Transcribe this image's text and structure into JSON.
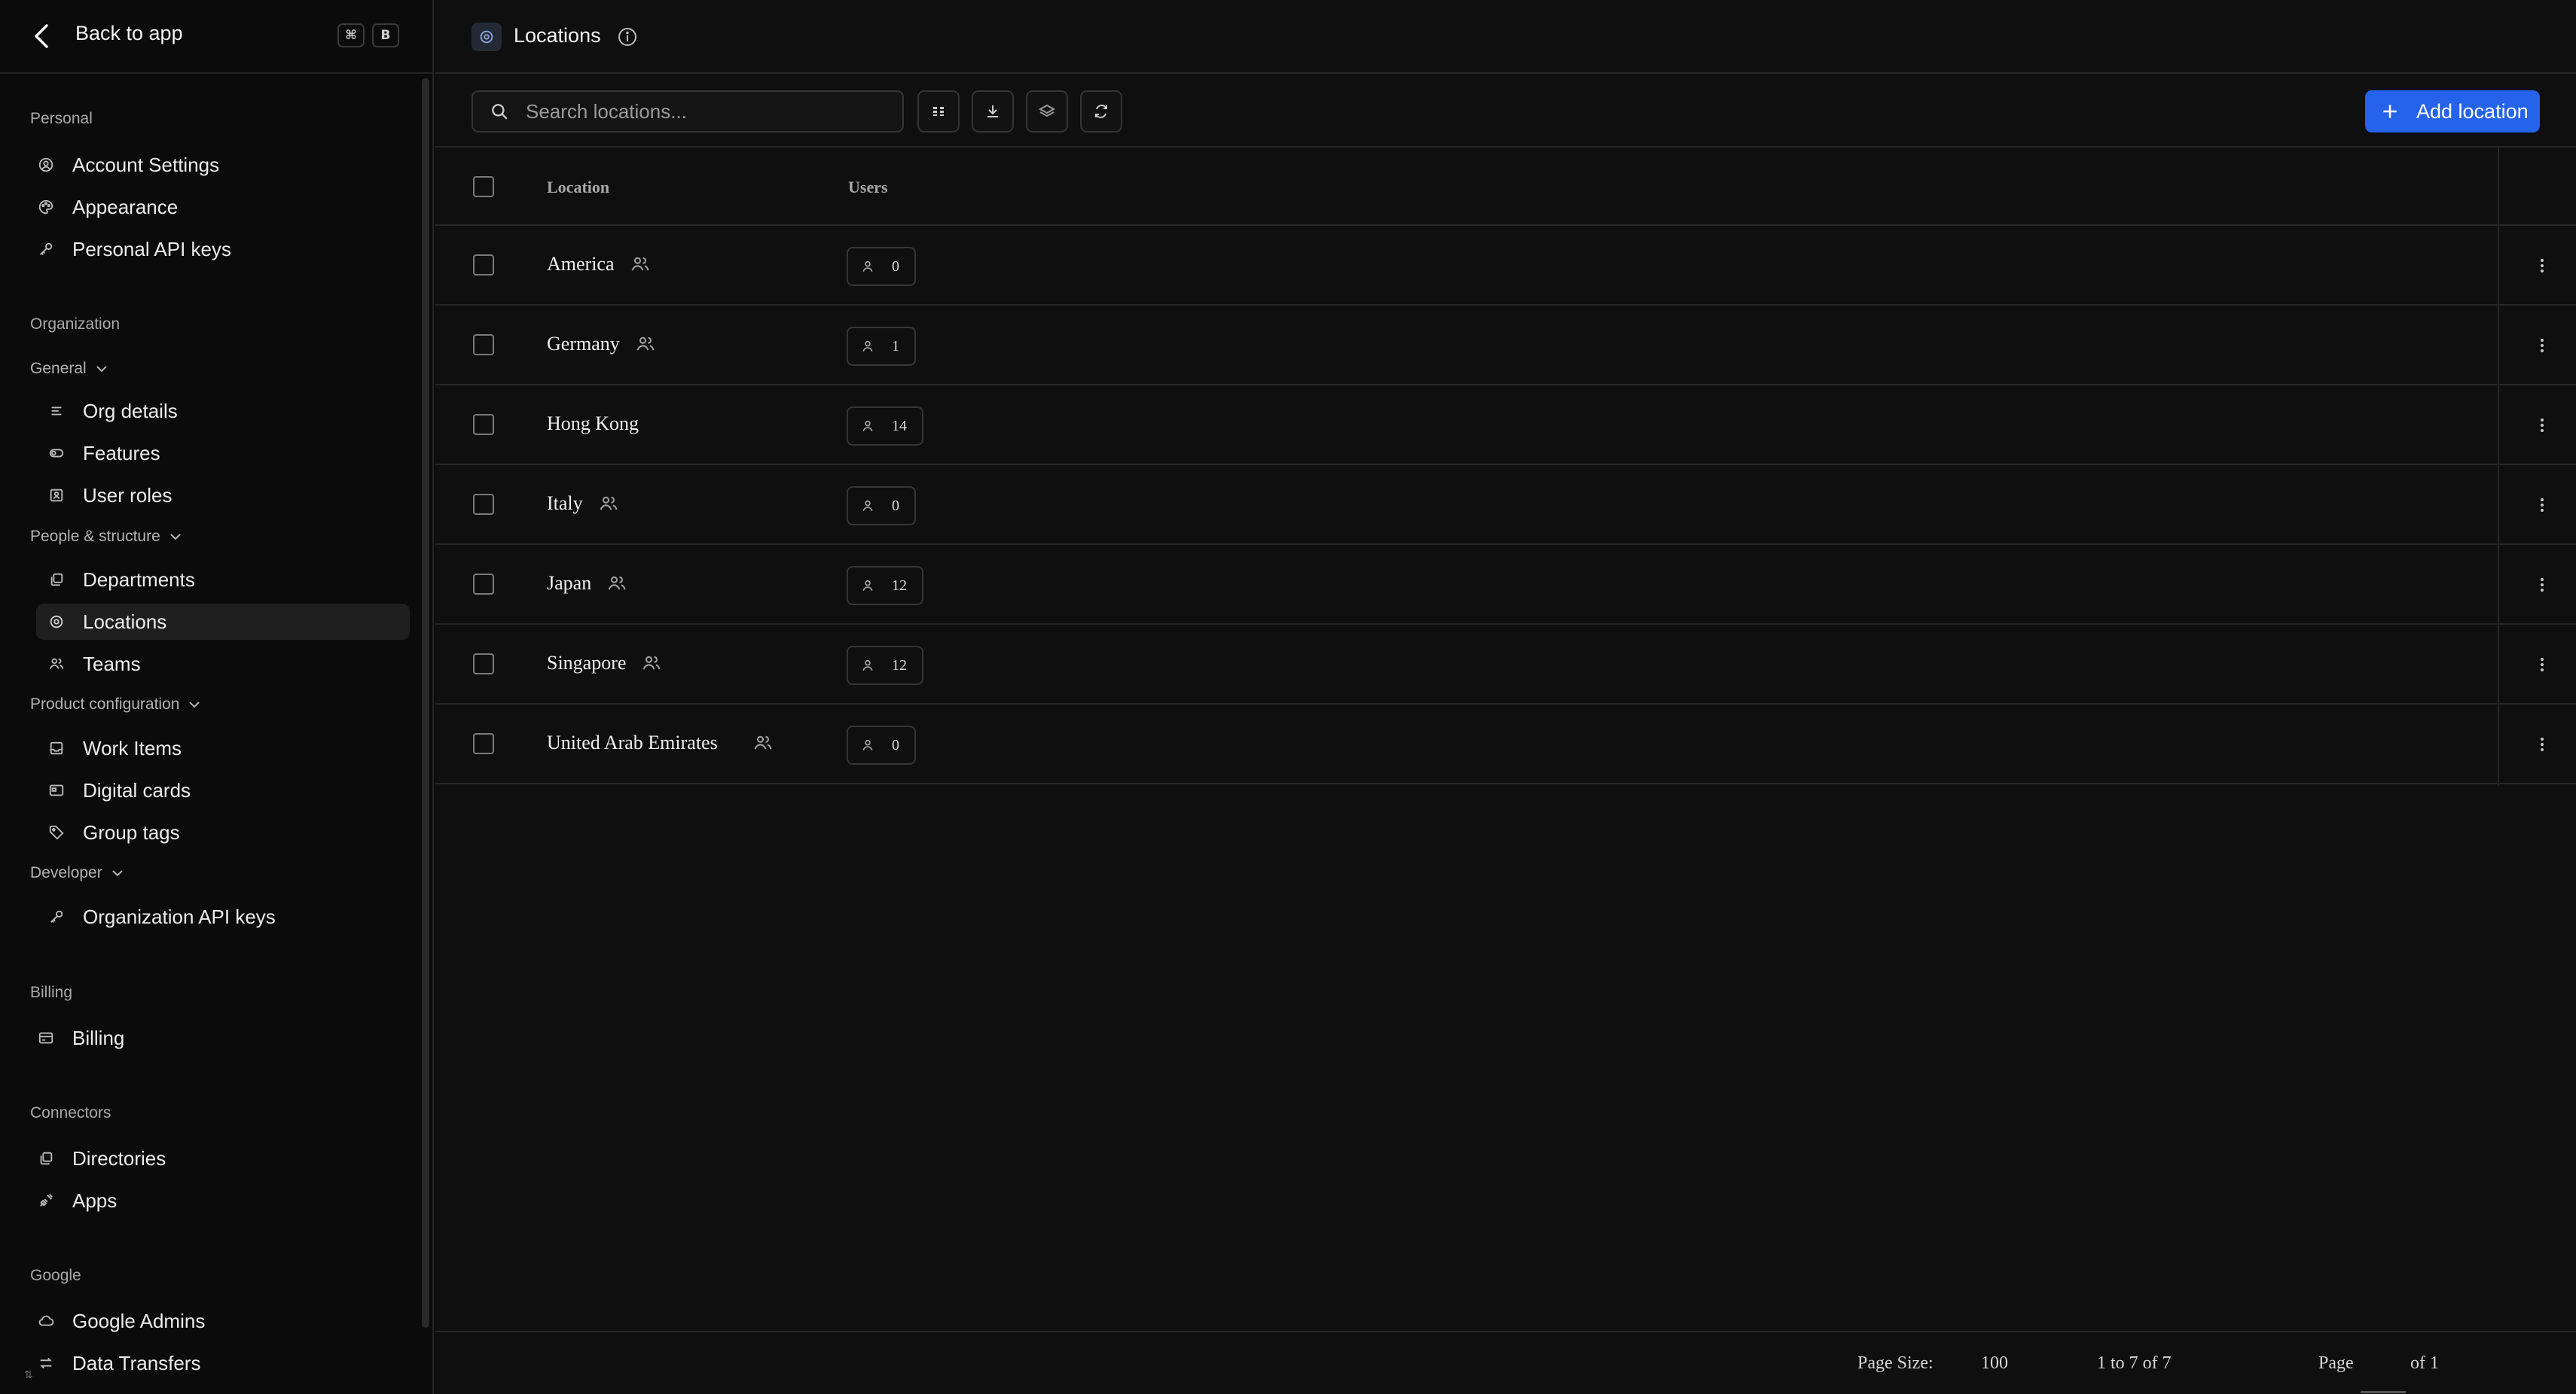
{
  "sidebar": {
    "back_label": "Back to app",
    "shortcut": [
      "⌘",
      "B"
    ],
    "sections": {
      "personal": "Personal",
      "organization": "Organization",
      "billing": "Billing",
      "connectors": "Connectors",
      "google": "Google"
    },
    "groups": {
      "general": "General",
      "people": "People & structure",
      "product": "Product configuration",
      "developer": "Developer"
    },
    "items": {
      "account_settings": "Account Settings",
      "appearance": "Appearance",
      "personal_api_keys": "Personal API keys",
      "org_details": "Org details",
      "features": "Features",
      "user_roles": "User roles",
      "departments": "Departments",
      "locations": "Locations",
      "teams": "Teams",
      "work_items": "Work Items",
      "digital_cards": "Digital cards",
      "group_tags": "Group tags",
      "org_api_keys": "Organization API keys",
      "billing": "Billing",
      "directories": "Directories",
      "apps": "Apps",
      "google_admins": "Google Admins",
      "data_transfers": "Data Transfers"
    },
    "active_item": "locations",
    "bottom_glyph": "⇅"
  },
  "header": {
    "title": "Locations"
  },
  "toolbar": {
    "search_placeholder": "Search locations...",
    "add_label": "Add location",
    "accent": "#2563eb"
  },
  "table": {
    "columns": [
      "Location",
      "Users"
    ],
    "rows": [
      {
        "location": "America",
        "users": "0",
        "team_icon": true
      },
      {
        "location": "Germany",
        "users": "1",
        "team_icon": true
      },
      {
        "location": "Hong Kong",
        "users": "14",
        "team_icon": false
      },
      {
        "location": "Italy",
        "users": "0",
        "team_icon": true
      },
      {
        "location": "Japan",
        "users": "12",
        "team_icon": true
      },
      {
        "location": "Singapore",
        "users": "12",
        "team_icon": true
      },
      {
        "location": "United Arab Emirates",
        "users": "0",
        "team_icon": true
      }
    ]
  },
  "footer": {
    "page_size_label": "Page Size:",
    "page_size": "100",
    "range": "1 to 7 of 7",
    "page_label": "Page",
    "page_of": "of 1"
  }
}
